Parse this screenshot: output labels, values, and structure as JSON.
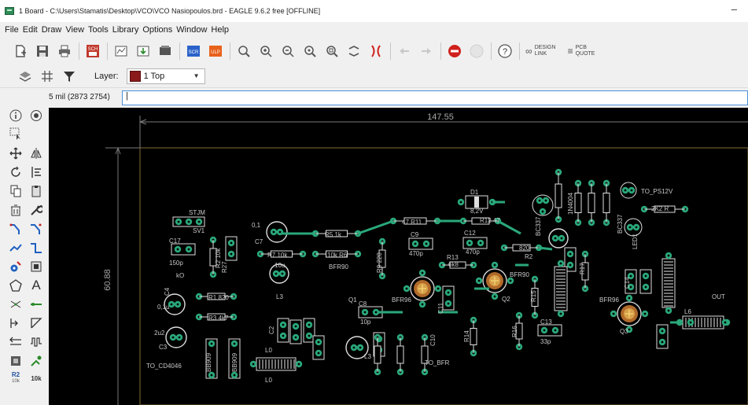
{
  "window": {
    "title": "1 Board - C:\\Users\\Stamatis\\Desktop\\VCO\\VCO Nasiopoulos.brd - EAGLE 9.6.2 free [OFFLINE]",
    "minimize": "–"
  },
  "menu": [
    "File",
    "Edit",
    "Draw",
    "View",
    "Tools",
    "Library",
    "Options",
    "Window",
    "Help"
  ],
  "toolbar": {
    "sch_label": "SCH",
    "scr_label": "SCR",
    "ulp_label": "ULP",
    "help_label": "?",
    "design_link": "DESIGN LINK",
    "pcb_quote": "PCB QUOTE"
  },
  "layer_bar": {
    "label": "Layer:",
    "selected": "1 Top",
    "color": "#8b1a1a"
  },
  "command": {
    "coord": "5 mil (2873 2754)",
    "value": "|"
  },
  "left_tools": {
    "text_tool": "A",
    "r2_label": "R2",
    "r2_value": "10k",
    "ten_k": "10k"
  },
  "board": {
    "dim_horizontal": "147.55",
    "dim_vertical": "60.88",
    "labels": {
      "stjm": "STJM",
      "sv1": "SV1",
      "c17": "C17",
      "c17v": "150p",
      "ko": "kO",
      "c4v": "0,1u",
      "c4": "C4",
      "c3v": "2u2",
      "c3": "C3",
      "to_cd": "TO_CD4046",
      "r1": "R1 820",
      "r3": "R3 4k7",
      "r2a": "R2 10k",
      "r27": "R27",
      "c7v": "0,1",
      "c7": "C7",
      "r5": "R5 1k",
      "r7": "R7 10k",
      "r6": "10k R6",
      "c6v": "10u",
      "l3": "L3",
      "l3b": "L3",
      "r11": "47 R11",
      "r9": "R9 220",
      "c9": "C9",
      "c9v": "470p",
      "bfr90a": "BFR90",
      "bfr90b": "BFR90",
      "bfr96a": "BFR96",
      "bfr96b": "BFR96",
      "q1": "Q1",
      "q2": "Q2",
      "q3": "Q3",
      "c8": "C8",
      "c8v": "10p",
      "c2": "C2",
      "d1": "D1",
      "d1v": "8,2V",
      "r12": "R12 47",
      "c12": "C12",
      "c12v": "470p",
      "r13": "R13",
      "r13v": "6k8",
      "r2b": "R2",
      "r2bv": "820",
      "to_ps": "TO_PS12V",
      "r_2k2": "2K2 R",
      "bc337a": "BC337",
      "bc337b": "BC337",
      "n4004": "1N4004",
      "led1": "LED1",
      "c11": "C11",
      "r14": "R14",
      "r15": "R15",
      "r16": "R16",
      "r17": "R17",
      "c13": "C13",
      "c13v": "33p",
      "c14": "C14",
      "c10": "C10",
      "l6": "L6",
      "out": "OUT",
      "to_bfr": "TO_BFR",
      "l0": "L0",
      "l0b": "L0",
      "bb909a": "BB909",
      "bb909b": "BB909"
    }
  }
}
